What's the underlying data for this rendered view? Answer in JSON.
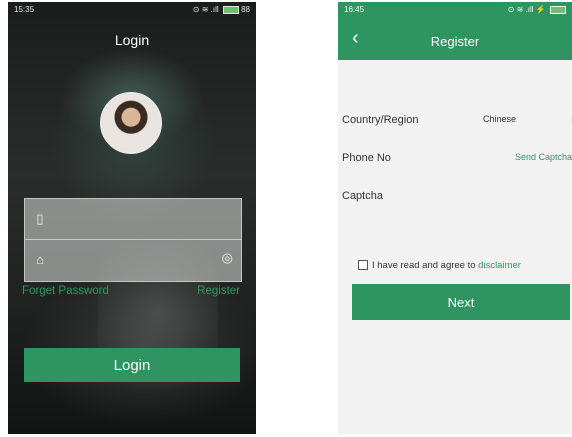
{
  "login": {
    "status": {
      "time": "15:35",
      "signal": "⊙ ≋ .ıll",
      "battery": "88"
    },
    "title": "Login",
    "forgot_password": "Forget Password",
    "register_link": "Register",
    "login_button": "Login"
  },
  "register": {
    "status": {
      "time": "16:45",
      "signal": "⊙ ≋ .ıll ⚡"
    },
    "title": "Register",
    "country_label": "Country/Region",
    "country_value": "Chinese",
    "phone_label": "Phone No",
    "send_captcha": "Send Captcha",
    "captcha_label": "Captcha",
    "agree_text": "I have read and agree to",
    "disclaimer": "disclaimer",
    "next_button": "Next"
  },
  "colors": {
    "accent": "#2f9560",
    "link": "#2c9b63"
  },
  "icons": [
    "user-icon",
    "lock-icon",
    "eye-icon",
    "back-arrow-icon",
    "chevron-right-icon"
  ]
}
